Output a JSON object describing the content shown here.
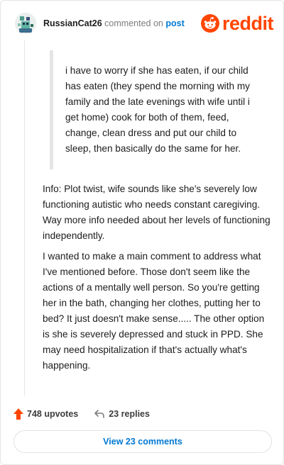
{
  "comment": {
    "username": "RussianCat26",
    "action_text": "commented on",
    "post_link": "post",
    "brand": "reddit",
    "quote": "i have to worry if she has eaten, if our child has eaten (they spend the morning with my family and the late evenings with wife until i get home) cook for both of them, feed, change, clean dress and put our child to sleep, then basically do the same for her.",
    "paragraphs": [
      "Info: Plot twist, wife sounds like she's severely low functioning autistic who needs constant caregiving. Way more info needed about her levels of functioning independently.",
      "I wanted to make a main comment to address what I've mentioned before. Those don't seem like the actions of a mentally well person. So you're getting her in the bath, changing her clothes, putting her to bed? It just doesn't make sense..... The other option is she is severely depressed and stuck in PPD. She may need hospitalization if that's actually what's happening."
    ]
  },
  "actions": {
    "upvotes": "748 upvotes",
    "replies": "23 replies"
  },
  "view_button": "View 23 comments",
  "colors": {
    "brand_orange": "#ff4500",
    "link_blue": "#0079d3"
  },
  "icons": [
    "avatar",
    "reddit-alien-icon",
    "upvote-arrow-icon",
    "reply-icon"
  ]
}
